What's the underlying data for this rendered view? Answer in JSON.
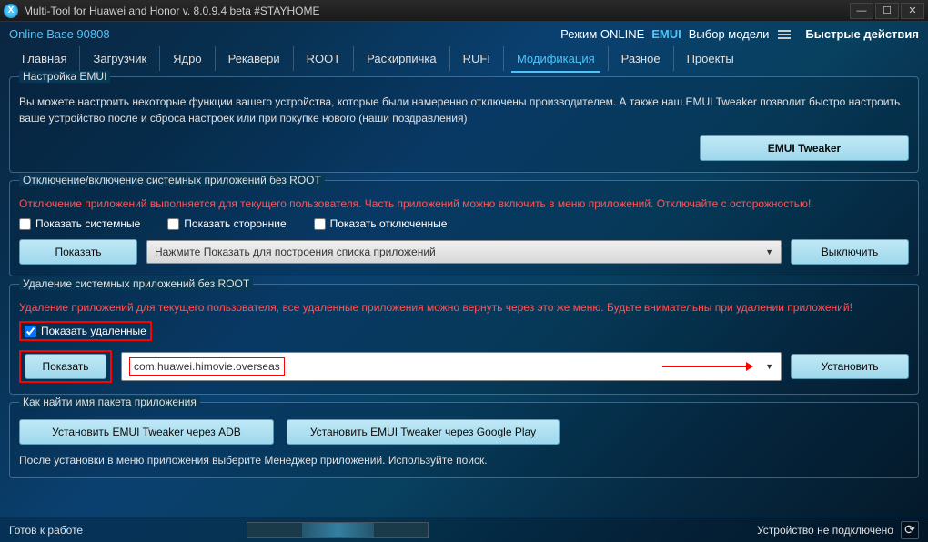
{
  "window": {
    "title": "Multi-Tool for Huawei and Honor v. 8.0.9.4 beta #STAYHOME"
  },
  "header": {
    "online_base": "Online Base 90808",
    "mode_label": "Режим ONLINE",
    "emui": "EMUI",
    "model_select": "Выбор модели",
    "quick_actions": "Быстрые действия"
  },
  "tabs": [
    {
      "label": "Главная"
    },
    {
      "label": "Загрузчик"
    },
    {
      "label": "Ядро"
    },
    {
      "label": "Рекавери"
    },
    {
      "label": "ROOT"
    },
    {
      "label": "Раскирпичка"
    },
    {
      "label": "RUFI"
    },
    {
      "label": "Модификация",
      "active": true
    },
    {
      "label": "Разное"
    },
    {
      "label": "Проекты"
    }
  ],
  "group_emui": {
    "title": "Настройка EMUI",
    "desc": "Вы можете настроить некоторые функции вашего устройства, которые были намеренно отключены производителем. А также наш EMUI Tweaker позволит быстро настроить ваше устройство после и сброса настроек или при покупке нового (наши поздравления)",
    "button": "EMUI Tweaker"
  },
  "group_disable": {
    "title": "Отключение/включение системных приложений без ROOT",
    "warning": "Отключение приложений выполняется для текущего пользователя. Часть приложений можно включить в меню приложений. Отключайте с осторожностью!",
    "chk_system": "Показать системные",
    "chk_thirdparty": "Показать сторонние",
    "chk_disabled": "Показать отключенные",
    "show_btn": "Показать",
    "combo_placeholder": "Нажмите Показать для построения списка приложений",
    "off_btn": "Выключить"
  },
  "group_delete": {
    "title": "Удаление системных приложений без ROOT",
    "warning": "Удаление приложений для текущего пользователя, все удаленные приложения можно вернуть через это же меню. Будьте внимательны при удалении приложений!",
    "chk_deleted": "Показать удаленные",
    "show_btn": "Показать",
    "combo_value": "com.huawei.himovie.overseas",
    "install_btn": "Установить"
  },
  "group_pkgname": {
    "title": "Как найти имя пакета приложения",
    "btn_adb": "Установить EMUI Tweaker через ADB",
    "btn_gplay": "Установить EMUI Tweaker через Google Play",
    "info": "После установки в меню приложения выберите Менеджер приложений. Используйте поиск."
  },
  "status": {
    "left": "Готов к работе",
    "right": "Устройство не подключено"
  }
}
